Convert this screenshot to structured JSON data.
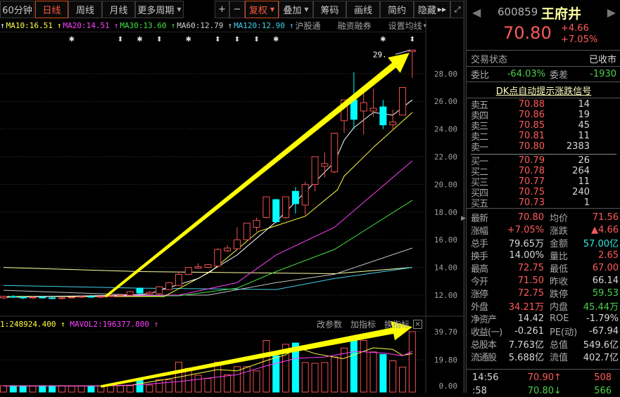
{
  "toolbar": {
    "periods": [
      "60分钟",
      "日线",
      "周线",
      "月线",
      "更多周期"
    ],
    "active_period": "日线",
    "right_buttons": [
      "+",
      "−",
      "复权",
      "叠加",
      "筹码",
      "画线",
      "简约",
      "隐藏"
    ],
    "expand_icon": "expand-icon"
  },
  "ma_labels": {
    "ma10": "MA10:16.51",
    "ma20": "MA20:14.51",
    "ma30": "MA30:13.60",
    "ma60": "MA60:12.79",
    "ma120": "MA120:12.90",
    "hgt": "沪股通",
    "margin": "融资融券",
    "settings": "设置均线"
  },
  "colors": {
    "up": "#f05050",
    "down": "#00ffff",
    "ma5": "#ffffff",
    "ma10": "#ffff40",
    "ma20": "#ff40ff",
    "ma30": "#40e040",
    "ma60": "#c0c0c0",
    "ma120": "#40d0e8",
    "ma250": "#ffffa0",
    "arrow": "#ffff00"
  },
  "chart_data": [
    {
      "type": "candlestick",
      "title": "日线",
      "y_ticks": [
        "28.00",
        "26.00",
        "24.00",
        "22.00",
        "20.00",
        "18.00",
        "16.00",
        "14.00",
        "12.00"
      ],
      "ylim": [
        11.5,
        30
      ],
      "max_label": "29.",
      "markers": [
        [
          7,
          "✱"
        ],
        [
          12,
          "⬍"
        ],
        [
          14,
          "✱"
        ],
        [
          16,
          "⬍"
        ],
        [
          19,
          "✱"
        ],
        [
          22,
          "⬍"
        ],
        [
          24,
          "⬍"
        ],
        [
          26,
          "⬍"
        ],
        [
          28,
          "✱"
        ],
        [
          39,
          "✱"
        ],
        [
          42,
          "⬍"
        ]
      ],
      "ohlc": [
        [
          11.8,
          11.95,
          11.7,
          11.9
        ],
        [
          11.9,
          12.0,
          11.8,
          11.85
        ],
        [
          11.85,
          11.9,
          11.7,
          11.8
        ],
        [
          11.8,
          11.9,
          11.75,
          11.85
        ],
        [
          11.85,
          11.95,
          11.75,
          11.8
        ],
        [
          11.8,
          11.9,
          11.7,
          11.75
        ],
        [
          11.75,
          11.85,
          11.7,
          11.8
        ],
        [
          11.8,
          11.9,
          11.75,
          11.85
        ],
        [
          11.85,
          11.95,
          11.8,
          11.9
        ],
        [
          11.9,
          12.0,
          11.8,
          11.85
        ],
        [
          11.85,
          11.95,
          11.8,
          11.9
        ],
        [
          11.9,
          12.0,
          11.85,
          11.95
        ],
        [
          11.95,
          12.05,
          11.85,
          12.0
        ],
        [
          12.0,
          12.3,
          11.95,
          12.25
        ],
        [
          12.5,
          12.55,
          12.1,
          12.15
        ],
        [
          12.1,
          12.3,
          12.0,
          12.2
        ],
        [
          12.1,
          12.65,
          12.05,
          12.6
        ],
        [
          12.4,
          12.95,
          12.35,
          12.9
        ],
        [
          12.7,
          13.7,
          12.65,
          13.5
        ],
        [
          13.5,
          14.0,
          13.45,
          14.0
        ],
        [
          13.95,
          14.3,
          13.9,
          14.05
        ],
        [
          14.0,
          14.25,
          13.95,
          14.2
        ],
        [
          14.1,
          15.4,
          14.05,
          15.3
        ],
        [
          15.2,
          15.6,
          15.1,
          15.4
        ],
        [
          15.35,
          16.9,
          15.3,
          16.0
        ],
        [
          16.0,
          17.2,
          15.95,
          17.2
        ],
        [
          16.9,
          17.6,
          16.6,
          17.4
        ],
        [
          17.6,
          19.1,
          17.55,
          19.1
        ],
        [
          18.9,
          18.95,
          17.2,
          17.3
        ],
        [
          17.6,
          19.1,
          17.5,
          19.1
        ],
        [
          19.5,
          19.8,
          17.9,
          18.6
        ],
        [
          18.5,
          20.2,
          17.8,
          20.0
        ],
        [
          20.0,
          22.0,
          19.5,
          22.0
        ],
        [
          21.3,
          22.3,
          20.5,
          21.5
        ],
        [
          20.9,
          23.7,
          20.8,
          23.7
        ],
        [
          24.6,
          26.1,
          23.7,
          26.1
        ],
        [
          26.1,
          28.1,
          24.0,
          24.7
        ],
        [
          25.3,
          26.9,
          23.6,
          25.9
        ],
        [
          25.3,
          26.9,
          24.9,
          25.5
        ],
        [
          25.6,
          26.1,
          24.0,
          24.3
        ],
        [
          24.3,
          25.4,
          23.9,
          24.5
        ],
        [
          25.0,
          27.0,
          25.0,
          27.0
        ],
        [
          29.6,
          29.7,
          27.7,
          29.7
        ]
      ],
      "ma_series": {
        "ma250": [
          [
            0,
            14.0
          ],
          [
            14,
            13.7
          ],
          [
            34,
            13.55
          ],
          [
            42,
            14.0
          ]
        ],
        "ma120": [
          [
            0,
            12.7
          ],
          [
            14,
            12.5
          ],
          [
            28,
            12.4
          ],
          [
            34,
            13.2
          ],
          [
            42,
            14.0
          ]
        ],
        "ma60": [
          [
            0,
            12.35
          ],
          [
            14,
            12.0
          ],
          [
            21,
            12.0
          ],
          [
            28,
            12.9
          ],
          [
            34,
            13.5
          ],
          [
            42,
            15.4
          ]
        ],
        "ma30": [
          [
            0,
            11.9
          ],
          [
            18,
            11.95
          ],
          [
            24,
            12.5
          ],
          [
            28,
            13.7
          ],
          [
            34,
            15.3
          ],
          [
            42,
            18.85
          ]
        ],
        "ma20": [
          [
            0,
            11.85
          ],
          [
            18,
            12.0
          ],
          [
            24,
            12.9
          ],
          [
            28,
            14.9
          ],
          [
            34,
            16.9
          ],
          [
            42,
            21.7
          ]
        ],
        "ma10": [
          [
            0,
            11.9
          ],
          [
            16.5,
            11.9
          ],
          [
            21.3,
            13.7
          ],
          [
            26.2,
            16.6
          ],
          [
            31,
            17.7
          ],
          [
            34.3,
            19.6
          ],
          [
            35,
            20.6
          ],
          [
            38.2,
            22.8
          ],
          [
            42,
            25.2
          ]
        ],
        "ma5": [
          [
            0,
            11.85
          ],
          [
            13,
            12.0
          ],
          [
            15,
            12.1
          ],
          [
            20,
            13.2
          ],
          [
            24,
            14.9
          ],
          [
            28,
            17.3
          ],
          [
            34,
            21.6
          ],
          [
            35,
            23.2
          ],
          [
            36,
            24.1
          ],
          [
            38,
            25.2
          ],
          [
            40,
            25.0
          ],
          [
            42,
            26.1
          ]
        ]
      },
      "trend_arrow": {
        "from": [
          10.5,
          11.9
        ],
        "to": [
          41.7,
          29.5
        ]
      }
    },
    {
      "type": "bar",
      "title": "VOL",
      "legend": {
        "vol_ma1": "1:248924.400",
        "vol_ma2": "MAVOL2:196377.800"
      },
      "y_ticks": [
        "39.70",
        "19.80",
        "0.00"
      ],
      "ylim": [
        0,
        39.7
      ],
      "values": [
        1.5,
        1.5,
        1.5,
        1.2,
        1.5,
        1.5,
        1.5,
        1.2,
        1.5,
        1.5,
        1.5,
        1.5,
        1.5,
        1.5,
        6.6,
        2,
        5.7,
        5.7,
        18.2,
        13.8,
        8.9,
        6.6,
        18.2,
        9.3,
        15,
        15,
        12,
        33.5,
        22.7,
        30.8,
        31.7,
        17.9,
        17.4,
        17.9,
        21.8,
        28.1,
        33.5,
        33.5,
        25.4,
        23.6,
        19.1,
        14.7,
        39.7
      ],
      "ma_series": {
        "mavol1": [
          [
            0,
            1.4
          ],
          [
            9.4,
            1.4
          ],
          [
            13,
            1.8
          ],
          [
            17.9,
            7.5
          ],
          [
            22,
            12.9
          ],
          [
            24,
            12
          ],
          [
            27,
            19.3
          ],
          [
            29,
            23.3
          ],
          [
            30.1,
            28.6
          ],
          [
            32,
            24.2
          ],
          [
            34.9,
            20.6
          ],
          [
            38,
            28.3
          ],
          [
            40,
            27.2
          ],
          [
            41,
            22.9
          ],
          [
            42,
            24.2
          ]
        ],
        "mavol2": [
          [
            0,
            1.4
          ],
          [
            10,
            1.4
          ],
          [
            14,
            2.2
          ],
          [
            17.9,
            4.3
          ],
          [
            24,
            9.3
          ],
          [
            27,
            15.6
          ],
          [
            30.1,
            20.9
          ],
          [
            33,
            21.8
          ],
          [
            36.2,
            25.8
          ],
          [
            39.2,
            24.5
          ],
          [
            41,
            22.7
          ],
          [
            42,
            25.8
          ]
        ]
      },
      "trend_arrow": {
        "from": [
          10,
          1
        ],
        "to": [
          42,
          43
        ]
      },
      "actions": [
        "改参数",
        "加指标",
        "换指标"
      ]
    }
  ],
  "quote": {
    "code": "600859",
    "name": "王府井",
    "price": "70.80",
    "change": "+4.66",
    "change_pct": "+7.05%",
    "status_label": "交易状态",
    "status": "已收市",
    "weibi_label": "委比",
    "weibi": "-64.03%",
    "weicha_label": "委差",
    "weicha": "-1930",
    "signal_link": "DK点自动提示涨跌信号",
    "asks": [
      {
        "label": "卖五",
        "price": "70.88",
        "vol": "14"
      },
      {
        "label": "卖四",
        "price": "70.86",
        "vol": "19"
      },
      {
        "label": "卖三",
        "price": "70.85",
        "vol": "45"
      },
      {
        "label": "卖二",
        "price": "70.81",
        "vol": "11"
      },
      {
        "label": "卖一",
        "price": "70.80",
        "vol": "2383"
      }
    ],
    "bids": [
      {
        "label": "买一",
        "price": "70.79",
        "vol": "26"
      },
      {
        "label": "买二",
        "price": "70.78",
        "vol": "264"
      },
      {
        "label": "买三",
        "price": "70.77",
        "vol": "11"
      },
      {
        "label": "买四",
        "price": "70.75",
        "vol": "240"
      },
      {
        "label": "买五",
        "price": "70.73",
        "vol": "1"
      }
    ],
    "stats": [
      {
        "l1": "最新",
        "v1": "70.80",
        "c1": "red",
        "l2": "均价",
        "v2": "71.56",
        "c2": "red"
      },
      {
        "l1": "涨幅",
        "v1": "+7.05%",
        "c1": "red",
        "l2": "涨跌",
        "v2": "▲4.66",
        "c2": "red"
      },
      {
        "l1": "总手",
        "v1": "79.65万",
        "c1": "white",
        "l2": "金额",
        "v2": "57.00亿",
        "c2": "cyan"
      },
      {
        "l1": "换手",
        "v1": "14.00%",
        "c1": "white",
        "l2": "量比",
        "v2": "2.65",
        "c2": "red"
      },
      {
        "l1": "最高",
        "v1": "72.75",
        "c1": "red",
        "l2": "最低",
        "v2": "67.00",
        "c2": "red"
      },
      {
        "l1": "今开",
        "v1": "71.50",
        "c1": "red",
        "l2": "昨收",
        "v2": "66.14",
        "c2": "white"
      },
      {
        "l1": "涨停",
        "v1": "72.75",
        "c1": "red",
        "l2": "跌停",
        "v2": "59.53",
        "c2": "green"
      },
      {
        "l1": "外盘",
        "v1": "34.21万",
        "c1": "red",
        "l2": "内盘",
        "v2": "45.44万",
        "c2": "green"
      },
      {
        "l1": "净资产",
        "v1": "14.42",
        "c1": "white",
        "l2": "ROE",
        "v2": "-1.79%",
        "c2": "white"
      },
      {
        "l1": "收益(一)",
        "v1": "-0.261",
        "c1": "white",
        "l2": "PE(动)",
        "v2": "-67.94",
        "c2": "white"
      },
      {
        "l1": "总股本",
        "v1": "7.763亿",
        "c1": "white",
        "l2": "总值",
        "v2": "549.6亿",
        "c2": "white"
      },
      {
        "l1": "流通股",
        "v1": "5.688亿",
        "c1": "white",
        "l2": "流值",
        "v2": "402.7亿",
        "c2": "white"
      }
    ],
    "ticks": [
      {
        "time": "14:56",
        "price": "70.90",
        "dir": "↑",
        "vol": "508",
        "c": "red"
      },
      {
        "time": ":58",
        "price": "70.80",
        "dir": "↓",
        "vol": "566",
        "c": "green"
      }
    ]
  }
}
